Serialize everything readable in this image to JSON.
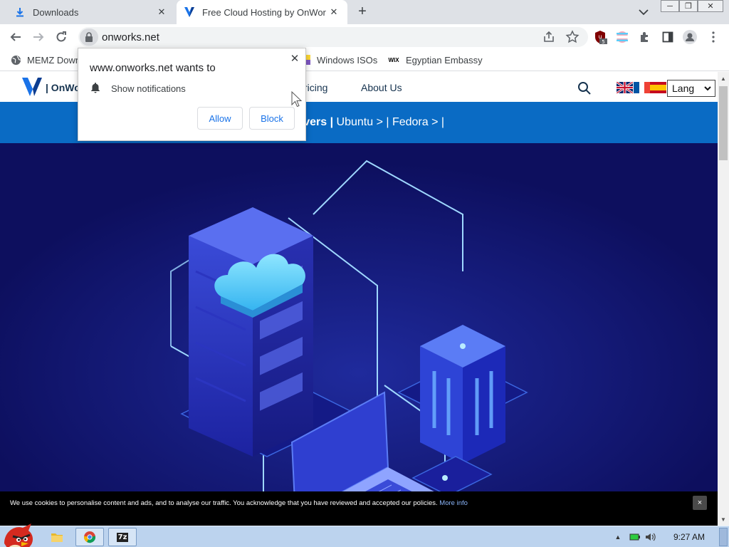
{
  "browser": {
    "tabs": [
      {
        "title": "Downloads",
        "icon": "download-icon",
        "active": false
      },
      {
        "title": "Free Cloud Hosting by OnWor",
        "icon": "onworks-logo",
        "active": true
      }
    ],
    "new_tab_label": "+",
    "address": {
      "url": "onworks.net"
    },
    "extension_badge": "5"
  },
  "bookmarks": [
    {
      "label": "MEMZ Down",
      "icon": "globe-icon"
    },
    {
      "label": "Windows ISOs",
      "icon": "windows-flag-icon"
    },
    {
      "label": "Egyptian Embassy",
      "icon": "wix-icon",
      "icon_text": "WIX"
    }
  ],
  "permission_popup": {
    "title": "www.onworks.net wants to",
    "item": "Show notifications",
    "allow_label": "Allow",
    "block_label": "Block"
  },
  "site": {
    "brand": "| OnWo",
    "nav": [
      {
        "label": "ricing"
      },
      {
        "label": "About Us"
      }
    ],
    "lang_label": "Lang",
    "blue_bar": {
      "bold_text": "rvers |",
      "rest_text": " Ubuntu > | Fedora > |"
    },
    "colors": {
      "blue_bar": "#0a6bc4",
      "hero": "#0d0f5e",
      "brand": "#16334f"
    }
  },
  "cookie_banner": {
    "text": "We use cookies to personalise content and ads, and to analyse our traffic. You acknowledge that you have reviewed and accepted our policies.",
    "link": "More info",
    "close_label": "×"
  },
  "taskbar": {
    "apps": [
      {
        "name": "file-explorer-icon"
      },
      {
        "name": "chrome-icon"
      },
      {
        "name": "7zip-icon",
        "label": "7z"
      }
    ],
    "clock": "9:27 AM"
  }
}
